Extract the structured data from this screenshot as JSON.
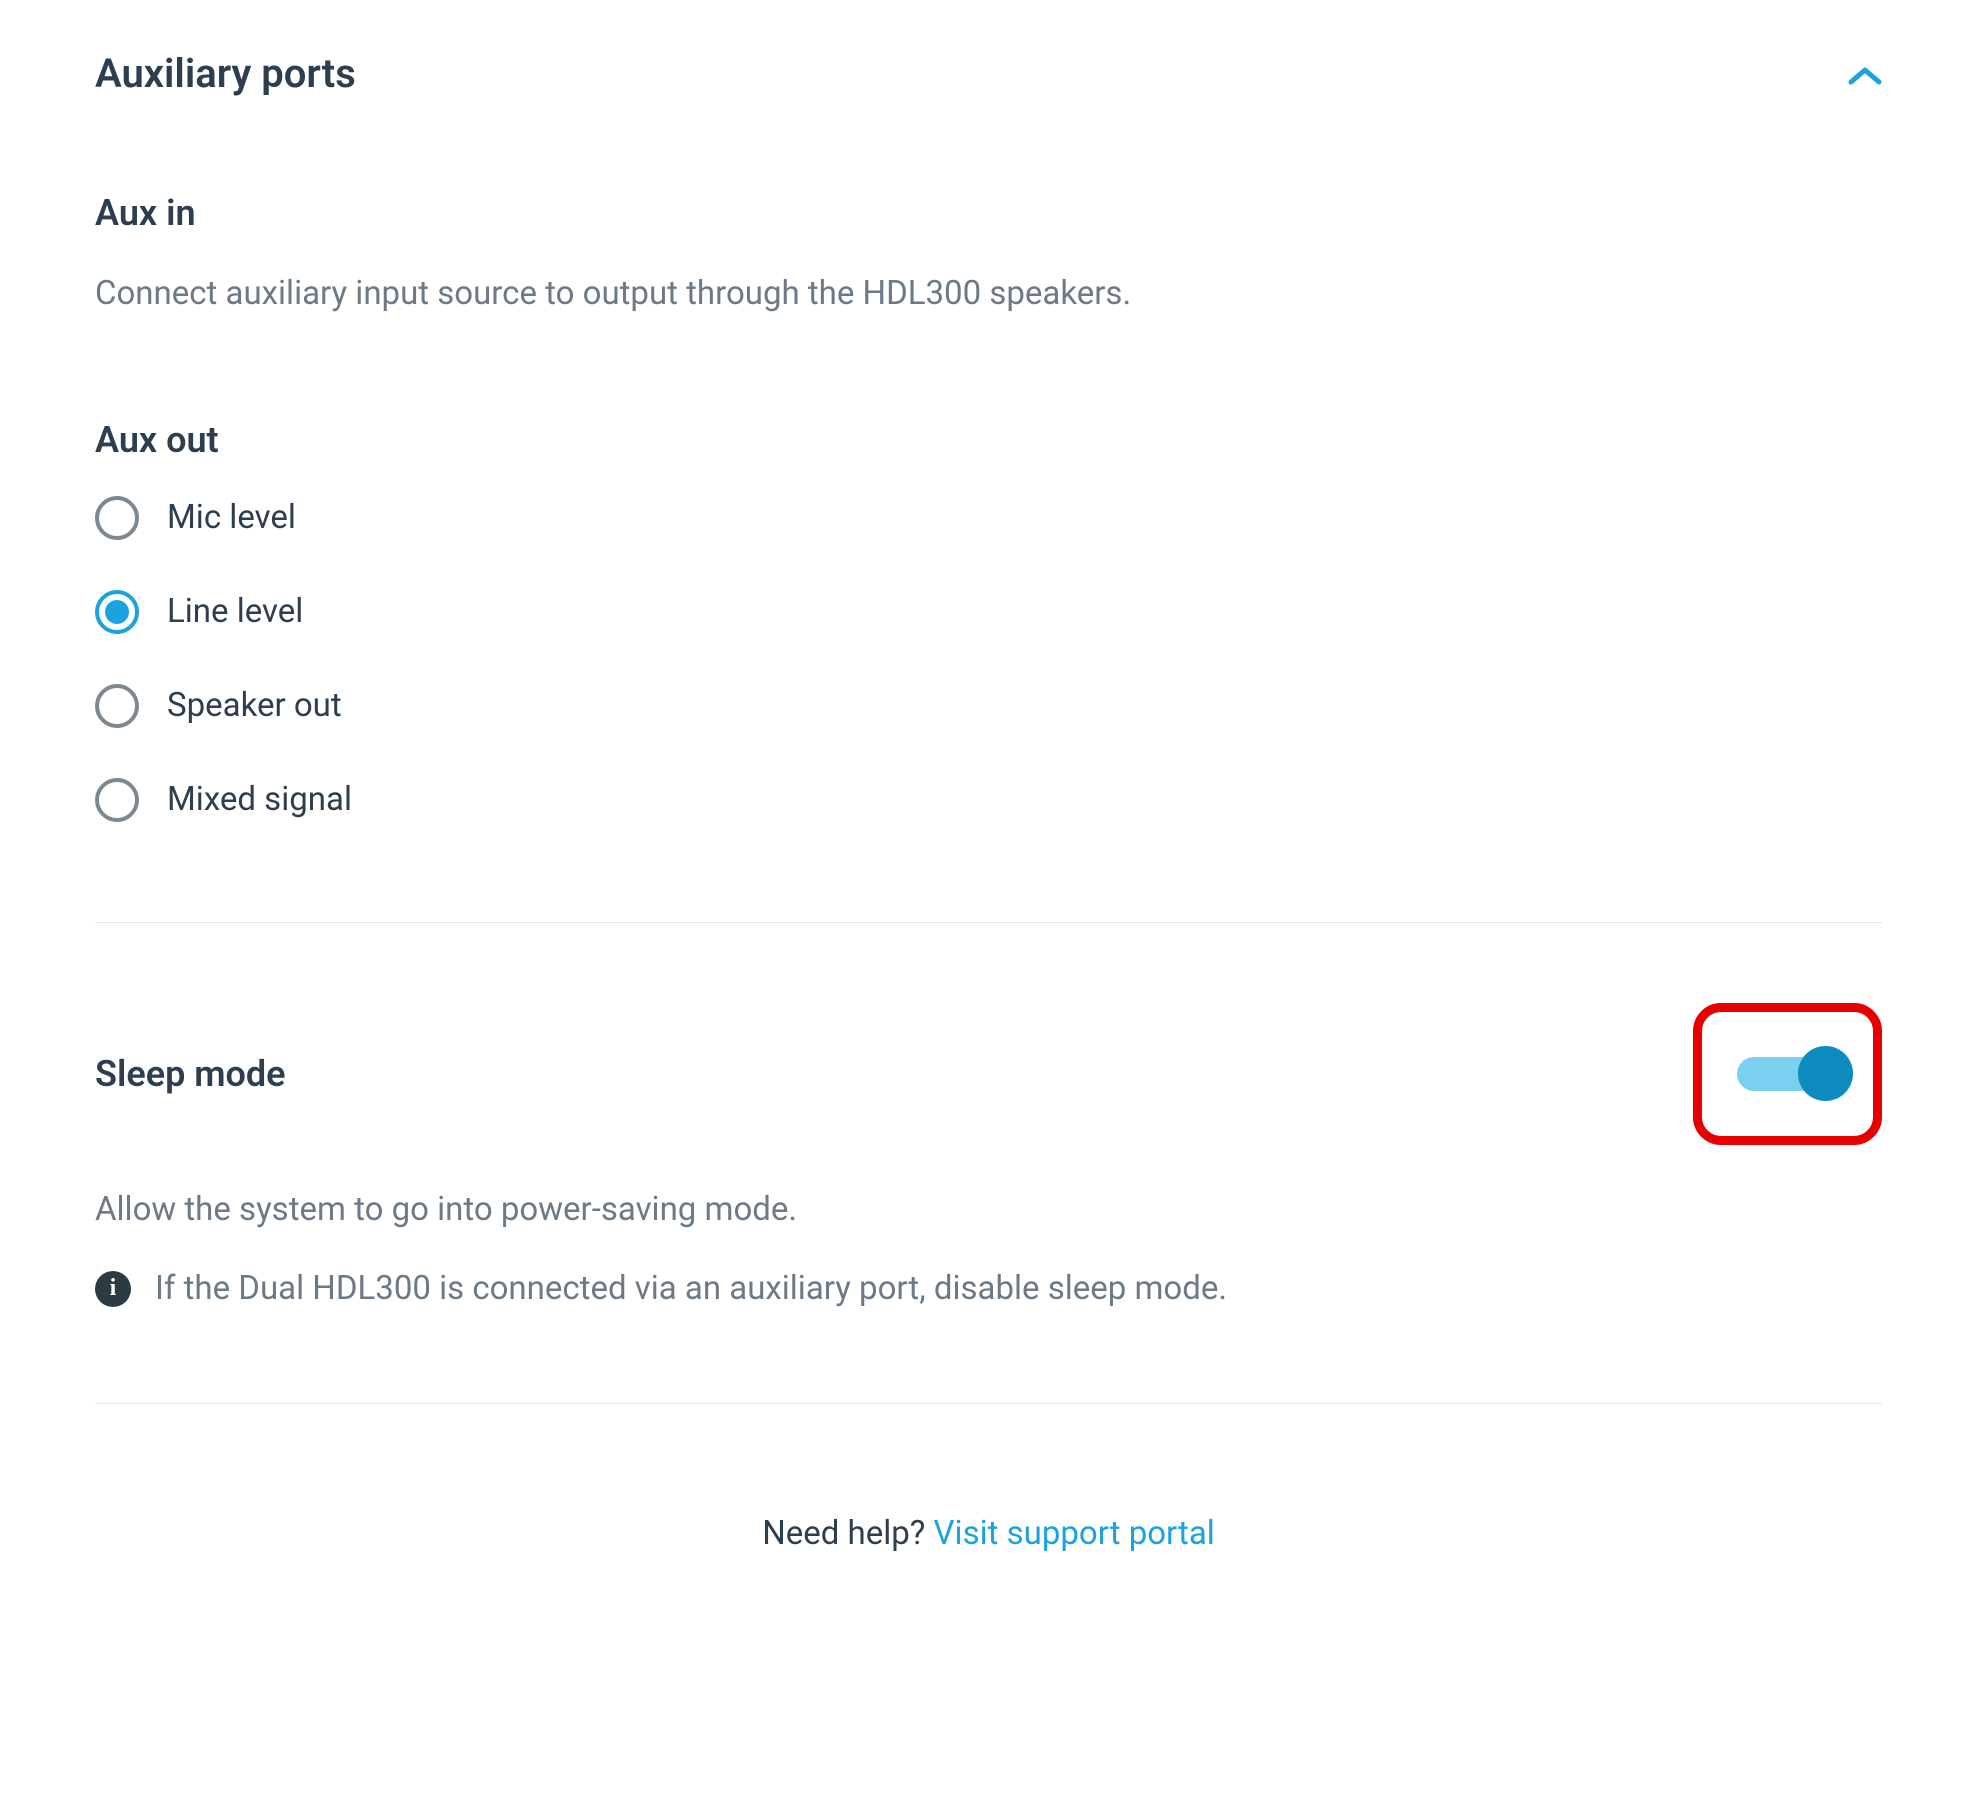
{
  "auxPorts": {
    "title": "Auxiliary ports",
    "expanded": true
  },
  "auxIn": {
    "title": "Aux in",
    "desc": "Connect auxiliary input source to output through the HDL300 speakers."
  },
  "auxOut": {
    "title": "Aux out",
    "options": [
      {
        "label": "Mic level",
        "selected": false
      },
      {
        "label": "Line level",
        "selected": true
      },
      {
        "label": "Speaker out",
        "selected": false
      },
      {
        "label": "Mixed signal",
        "selected": false
      }
    ]
  },
  "sleepMode": {
    "title": "Sleep mode",
    "desc": "Allow the system to go into power-saving mode.",
    "enabled": true,
    "info": "If the Dual HDL300 is connected via an auxiliary port, disable sleep mode."
  },
  "help": {
    "prefix": "Need help? ",
    "link": "Visit support portal"
  },
  "icons": {
    "info": "i"
  },
  "colors": {
    "accent": "#1ba3dd",
    "highlight": "#e60000"
  }
}
